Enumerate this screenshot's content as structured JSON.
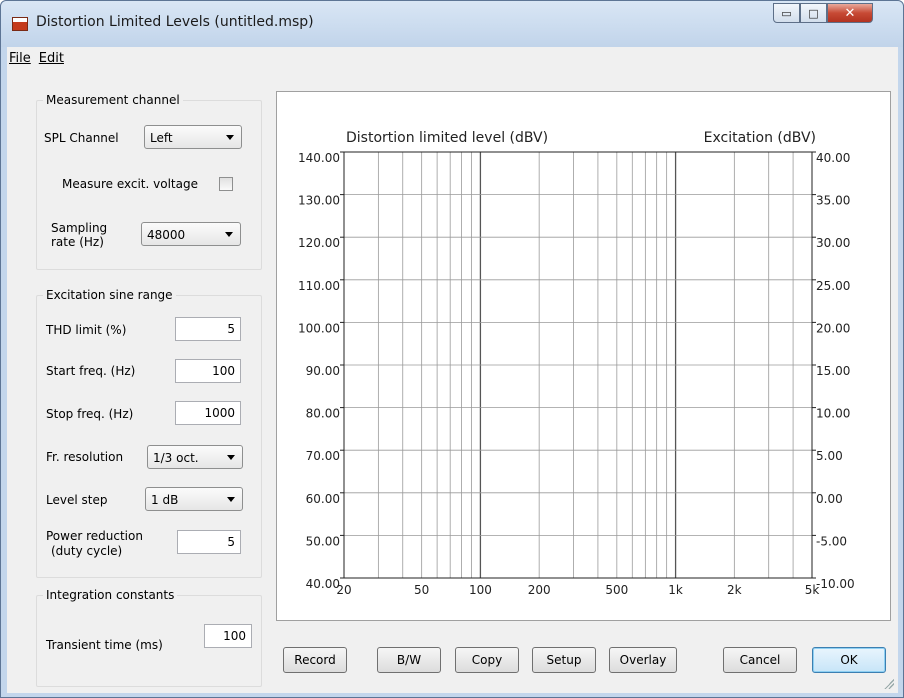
{
  "window": {
    "title": "Distortion Limited Levels (untitled.msp)",
    "caption_minimize": "▭",
    "caption_maximize": "□",
    "caption_close": "✕"
  },
  "menu": {
    "file": "File",
    "edit": "Edit"
  },
  "measurement_channel": {
    "title": "Measurement channel",
    "spl_channel_label": "SPL Channel",
    "spl_channel_value": "Left",
    "measure_excit_label": "Measure excit. voltage",
    "measure_excit_checked": false,
    "sampling_rate_label_1": "Sampling",
    "sampling_rate_label_2": "rate (Hz)",
    "sampling_rate_value": "48000"
  },
  "excitation": {
    "title": "Excitation sine range",
    "thd_label": "THD limit (%)",
    "thd_value": "5",
    "start_label": "Start freq. (Hz)",
    "start_value": "100",
    "stop_label": "Stop freq. (Hz)",
    "stop_value": "1000",
    "resolution_label": "Fr. resolution",
    "resolution_value": "1/3 oct.",
    "level_step_label": "Level step",
    "level_step_value": "1 dB",
    "power_reduction_label_1": "Power reduction",
    "power_reduction_label_2": "(duty cycle)",
    "power_reduction_value": "5"
  },
  "integration": {
    "title": "Integration constants",
    "transient_label": "Transient time (ms)",
    "transient_value": "100"
  },
  "buttons": {
    "record": "Record",
    "bw": "B/W",
    "copy": "Copy",
    "setup": "Setup",
    "overlay": "Overlay",
    "cancel": "Cancel",
    "ok": "OK"
  },
  "chart_data": {
    "type": "line",
    "title_left": "Distortion limited level (dBV)",
    "title_right": "Excitation (dBV)",
    "x_scale": "log",
    "xlim": [
      20,
      5000
    ],
    "x_ticks": [
      20,
      50,
      100,
      200,
      500,
      1000,
      2000,
      5000
    ],
    "x_tick_labels": [
      "20",
      "50",
      "100",
      "200",
      "500",
      "1k",
      "2k",
      "5k"
    ],
    "ylim_left": [
      40,
      140
    ],
    "y_left_ticks": [
      "40.00",
      "50.00",
      "60.00",
      "70.00",
      "80.00",
      "90.00",
      "100.00",
      "110.00",
      "120.00",
      "130.00",
      "140.00"
    ],
    "ylim_right": [
      -10,
      40
    ],
    "y_right_ticks": [
      "-10.00",
      "-5.00",
      "0.00",
      "5.00",
      "10.00",
      "15.00",
      "20.00",
      "25.00",
      "30.00",
      "35.00",
      "40.00"
    ],
    "grid": true,
    "series": []
  }
}
